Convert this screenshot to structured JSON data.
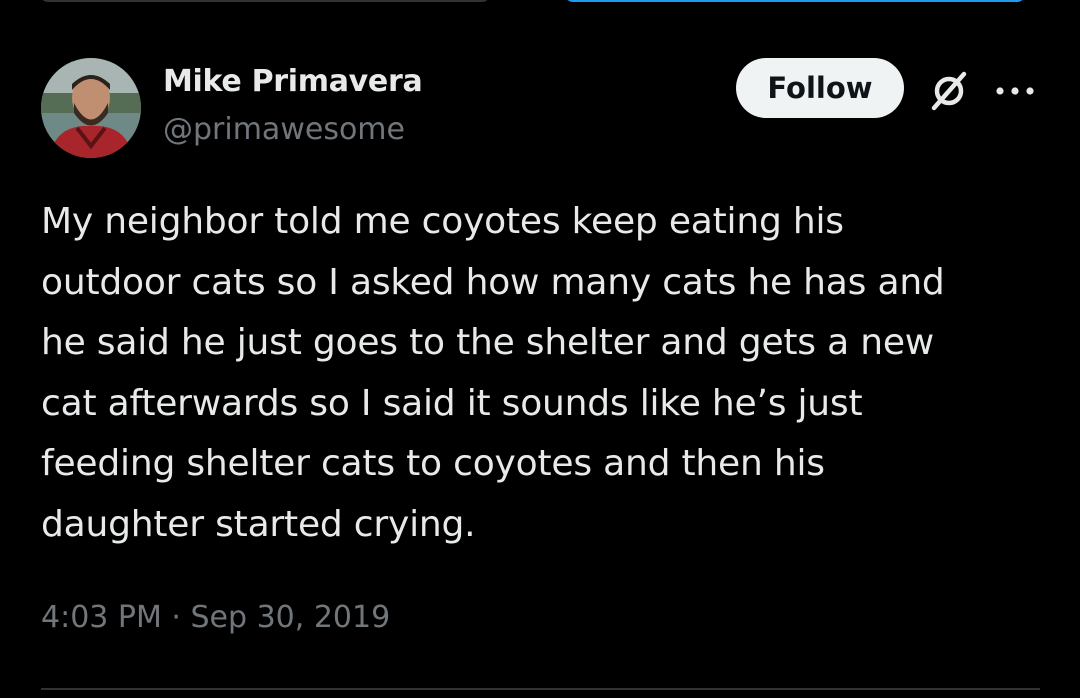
{
  "tweet": {
    "author": {
      "display_name": "Mike Primavera",
      "handle": "@primawesome",
      "avatar_icon": "user-avatar-photo"
    },
    "actions": {
      "follow_label": "Follow",
      "grok_icon": "grok-icon",
      "more_icon": "more-icon"
    },
    "text": "My neighbor told me coyotes keep eating his\noutdoor cats so I asked how many cats he has and\nhe said he just goes to the shelter and gets a new\ncat afterwards so I said it sounds like he’s just\nfeeding shelter cats to coyotes and then his\ndaughter started crying.",
    "timestamp": "4:03 PM · Sep 30, 2019"
  },
  "colors": {
    "background": "#000000",
    "primary_text": "#e7e9ea",
    "secondary_text": "#71767b",
    "follow_button_bg": "#eff3f4",
    "follow_button_text": "#0f1419",
    "accent": "#1d9bf0",
    "divider": "#2f3336"
  }
}
